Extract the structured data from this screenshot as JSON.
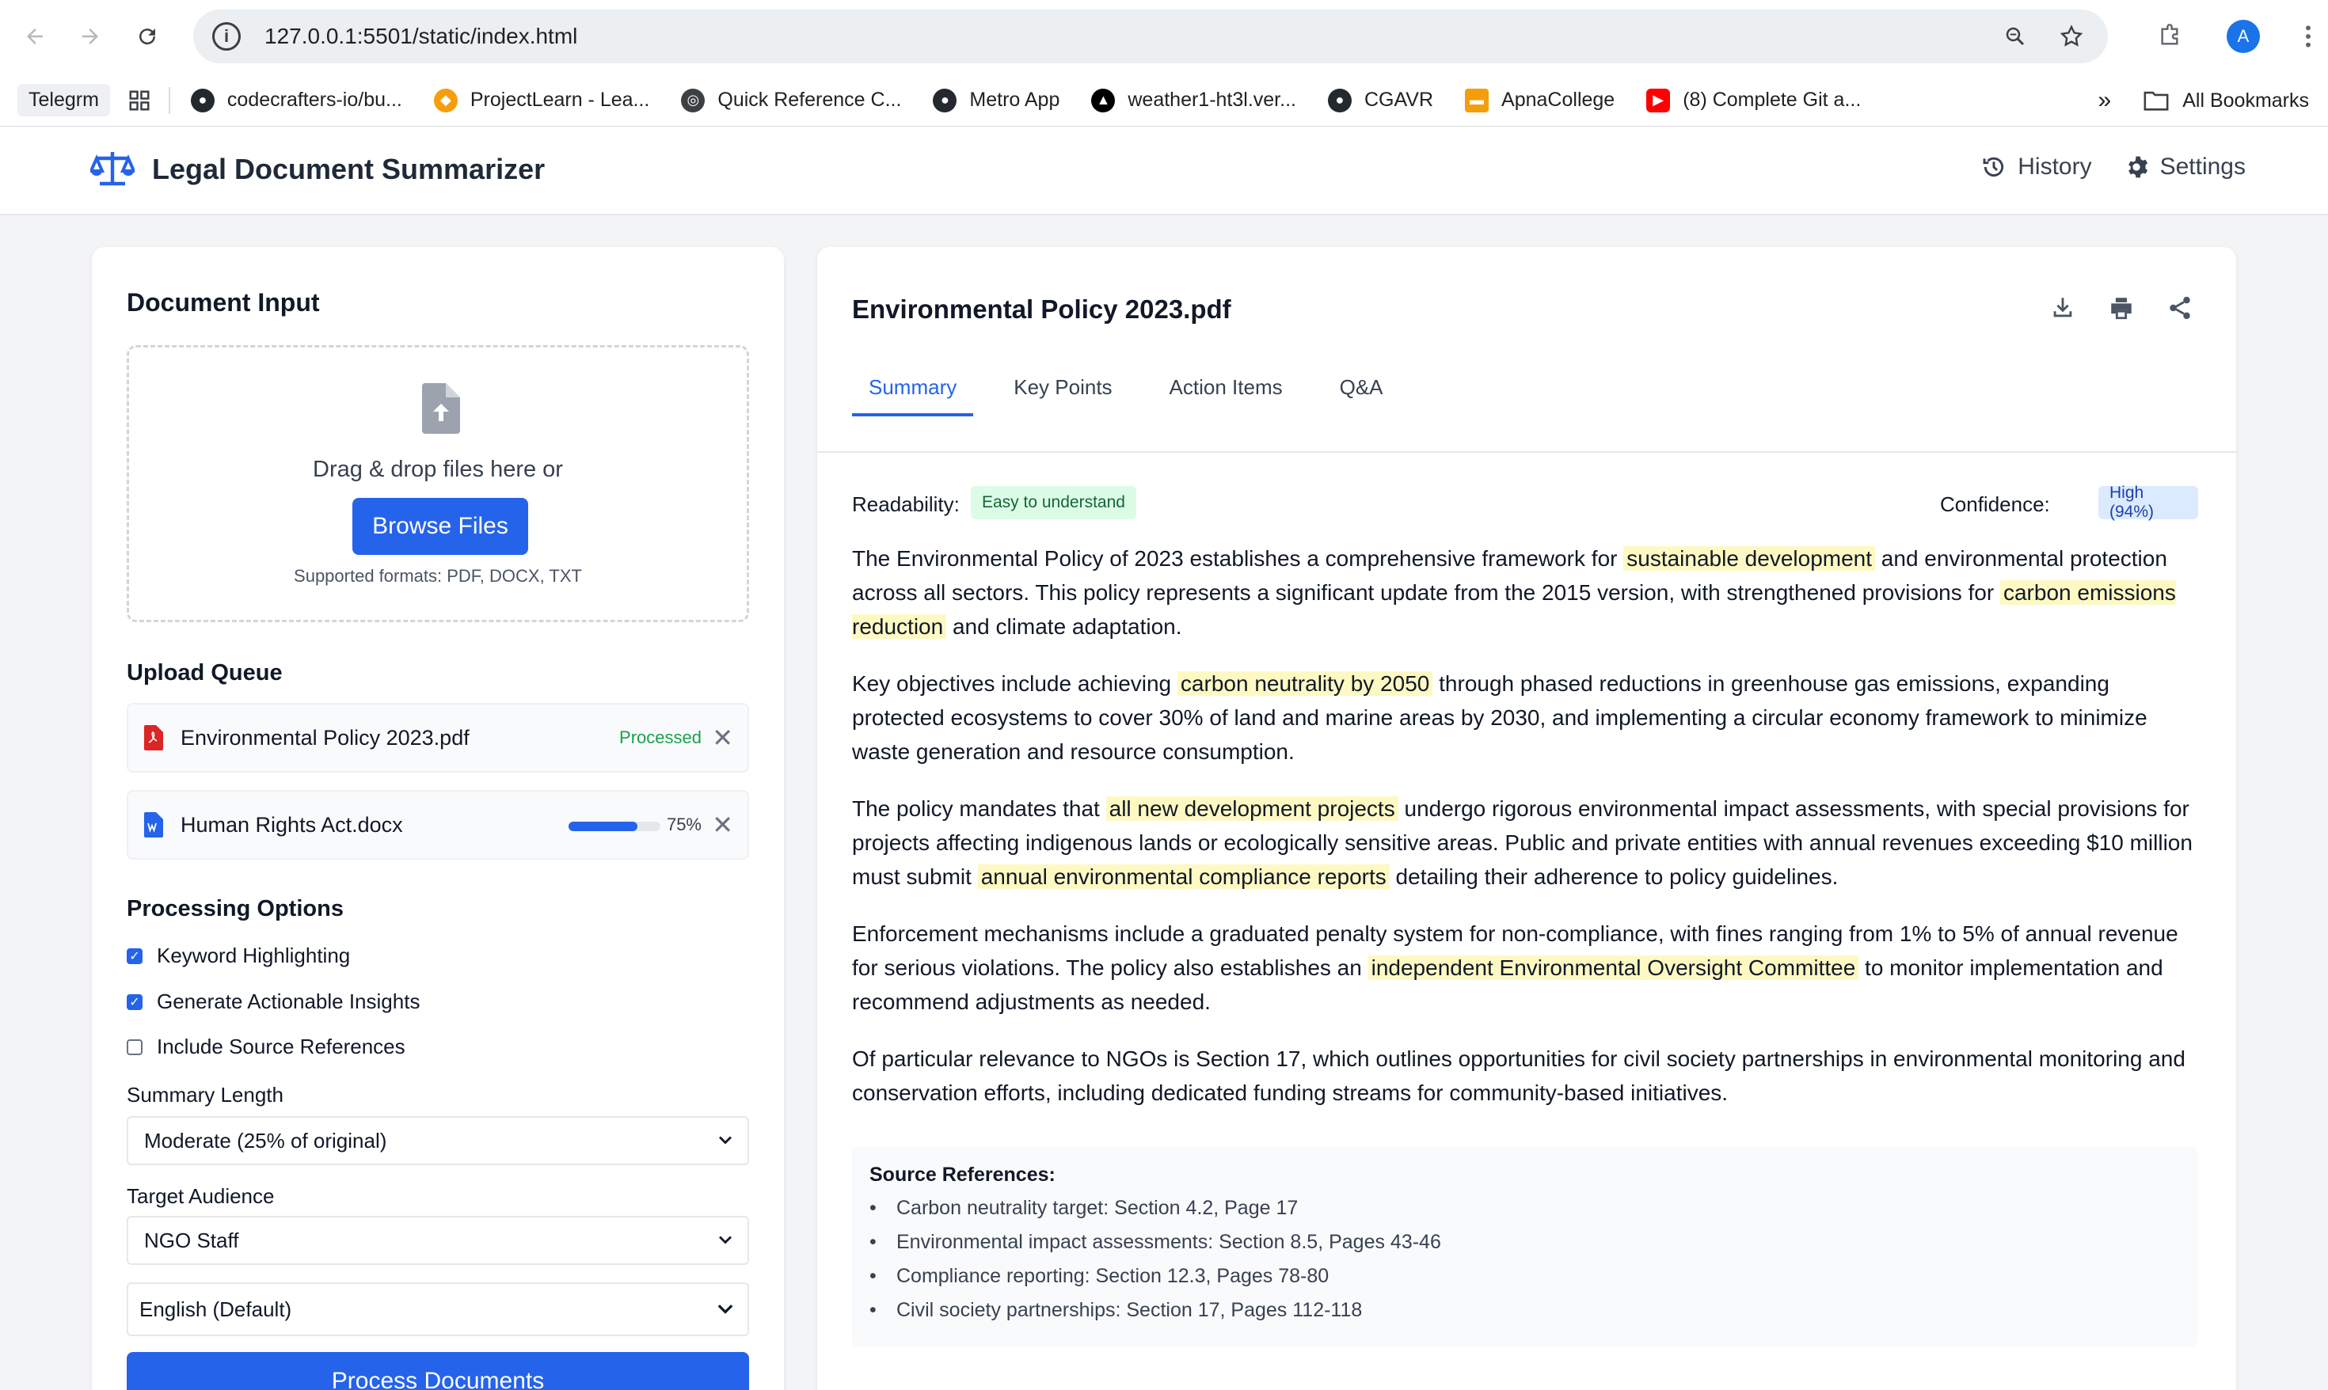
{
  "browser": {
    "url": "127.0.0.1:5501/static/index.html",
    "profile_initial": "A",
    "bookmarks": [
      {
        "label": "Telegrm",
        "color": "#6b7280"
      },
      {
        "label": "codecrafters-io/bu...",
        "color": "#24292f"
      },
      {
        "label": "ProjectLearn - Lea...",
        "color": "#f59e0b"
      },
      {
        "label": "Quick Reference C...",
        "color": "#3c4043"
      },
      {
        "label": "Metro App",
        "color": "#24292f"
      },
      {
        "label": "weather1-ht3l.ver...",
        "color": "#000000"
      },
      {
        "label": "CGAVR",
        "color": "#24292f"
      },
      {
        "label": "ApnaCollege",
        "color": "#f59e0b"
      },
      {
        "label": "(8) Complete Git a...",
        "color": "#ff0000"
      }
    ],
    "all_bookmarks": "All Bookmarks"
  },
  "app": {
    "title": "Legal Document Summarizer",
    "history_label": "History",
    "settings_label": "Settings"
  },
  "input": {
    "heading": "Document Input",
    "drop_text": "Drag & drop files here or",
    "browse_label": "Browse Files",
    "formats": "Supported formats: PDF, DOCX, TXT",
    "queue_heading": "Upload Queue",
    "queue": [
      {
        "name": "Environmental Policy 2023.pdf",
        "status": "Processed",
        "type": "pdf"
      },
      {
        "name": "Human Rights Act.docx",
        "progress": 0.75,
        "progress_label": "75%",
        "type": "docx"
      }
    ],
    "options_heading": "Processing Options",
    "options": [
      {
        "label": "Keyword Highlighting",
        "checked": true
      },
      {
        "label": "Generate Actionable Insights",
        "checked": true
      },
      {
        "label": "Include Source References",
        "checked": false
      }
    ],
    "summary_length_label": "Summary Length",
    "summary_length_value": "Moderate (25% of original)",
    "target_audience_label": "Target Audience",
    "target_audience_value": "NGO Staff",
    "language_value": "English (Default)",
    "process_label": "Process Documents"
  },
  "result": {
    "doc_title": "Environmental Policy 2023.pdf",
    "tabs": [
      "Summary",
      "Key Points",
      "Action Items",
      "Q&A"
    ],
    "active_tab": 0,
    "readability_label": "Readability:",
    "readability_value": "Easy to understand",
    "confidence_label": "Confidence:",
    "confidence_value": "High (94%)",
    "paragraphs": [
      [
        {
          "t": "The Environmental Policy of 2023 establishes a comprehensive framework for "
        },
        {
          "t": "sustainable development",
          "hl": true
        },
        {
          "t": " and environmental protection across all sectors. This policy represents a significant update from the 2015 version, with strengthened provisions for "
        },
        {
          "t": "carbon emissions reduction",
          "hl": true
        },
        {
          "t": " and climate adaptation."
        }
      ],
      [
        {
          "t": "Key objectives include achieving "
        },
        {
          "t": "carbon neutrality by 2050",
          "hl": true
        },
        {
          "t": " through phased reductions in greenhouse gas emissions, expanding protected ecosystems to cover 30% of land and marine areas by 2030, and implementing a circular economy framework to minimize waste generation and resource consumption."
        }
      ],
      [
        {
          "t": "The policy mandates that "
        },
        {
          "t": "all new development projects",
          "hl": true
        },
        {
          "t": " undergo rigorous environmental impact assessments, with special provisions for projects affecting indigenous lands or ecologically sensitive areas. Public and private entities with annual revenues exceeding $10 million must submit "
        },
        {
          "t": "annual environmental compliance reports",
          "hl": true
        },
        {
          "t": " detailing their adherence to policy guidelines."
        }
      ],
      [
        {
          "t": "Enforcement mechanisms include a graduated penalty system for non-compliance, with fines ranging from 1% to 5% of annual revenue for serious violations. The policy also establishes an "
        },
        {
          "t": "independent Environmental Oversight Committee",
          "hl": true
        },
        {
          "t": " to monitor implementation and recommend adjustments as needed."
        }
      ],
      [
        {
          "t": "Of particular relevance to NGOs is Section 17, which outlines opportunities for civil society partnerships in environmental monitoring and conservation efforts, including dedicated funding streams for community-based initiatives."
        }
      ]
    ],
    "references_heading": "Source References:",
    "references": [
      "Carbon neutrality target: Section 4.2, Page 17",
      "Environmental impact assessments: Section 8.5, Pages 43-46",
      "Compliance reporting: Section 12.3, Pages 78-80",
      "Civil society partnerships: Section 17, Pages 112-118"
    ]
  }
}
